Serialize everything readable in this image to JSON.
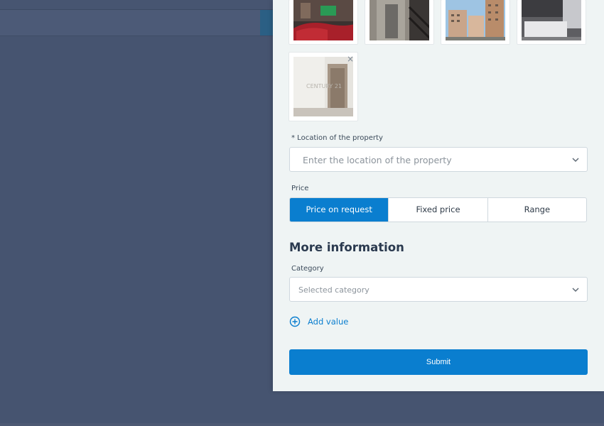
{
  "photos": {
    "remove_symbol": "×"
  },
  "location": {
    "label": "* Location of the property",
    "placeholder": "Enter the location of the property",
    "icon": "chevron-down-icon"
  },
  "price": {
    "label": "Price",
    "options": [
      "Price on request",
      "Fixed price",
      "Range"
    ],
    "selected": "Price on request"
  },
  "more_information": {
    "title": "More information",
    "category_label": "Category",
    "category_placeholder": "Selected category",
    "add_value_label": "Add value",
    "add_value_icon": "plus-circle-icon"
  },
  "submit_label": "Submit",
  "colors": {
    "accent": "#0a7ecf",
    "panel_bg": "#eff4f4",
    "overlay_bg": "#465470"
  }
}
